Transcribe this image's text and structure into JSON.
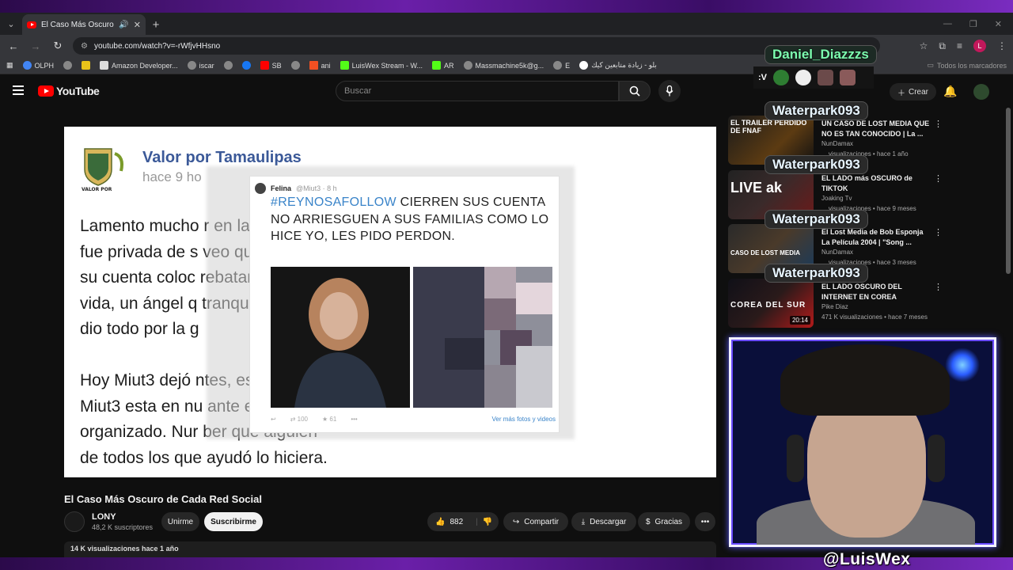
{
  "browser": {
    "tab_title": "El Caso Más Oscuro de Cad",
    "url": "youtube.com/watch?v=-rWfjvHHsno",
    "bookmarks": [
      "OLPH",
      "",
      "Amazon Developer...",
      "iscar",
      "",
      "",
      "SB",
      "",
      "ani",
      "LuisWex Stream - W...",
      "AR",
      "Massmachine5k@g...",
      "E",
      "بلو - زيادة متابعين كيك"
    ],
    "bookmarks_right": "Todos los marcadores",
    "avatar_letter": "L"
  },
  "youtube": {
    "logo_text": "YouTube",
    "search_placeholder": "Buscar",
    "create_label": "Crear"
  },
  "video": {
    "page_name": "Valor por Tamaulipas",
    "page_time": "hace 9 ho",
    "shield_caption": "VALOR POR TAMAULIPAS",
    "post_text": "Lamento mucho                                                    r en la mañana\nfue privada de s                                                 veo que desde\nsu cuenta coloc                                                  rebataron a\nvida, un ángel q                                                 tranquilidad, lo\ndio todo por la g\n\nHoy Miut3 dejó                                                  ntes, es que\nMiut3 esta en nu                                                 ante el crimen\norganizado. Nur                                                  ber que alguien\nde todos los que ayudó lo hiciera.",
    "tweet": {
      "name": "Felina",
      "handle": "@Miut3 · 8 h",
      "hashtag": "#REYNOSAFOLLOW",
      "text": " CIERREN SUS CUENTA NO ARRIESGUEN A SUS FAMILIAS COMO LO HICE YO,  LES PIDO PERDON.",
      "retweets": "100",
      "favs": "61",
      "more_link": "Ver más fotos y videos"
    },
    "title": "El Caso Más Oscuro de Cada Red Social",
    "channel": "LONY",
    "subscribers": "48,2 K suscriptores",
    "join_label": "Unirme",
    "subscribe_label": "Suscribirme",
    "likes": "882",
    "share_label": "Compartir",
    "download_label": "Descargar",
    "thanks_label": "Gracias",
    "views_line": "14 K visualizaciones  hace 1 año"
  },
  "recommendations": [
    {
      "overlay": "EL TRAILER PERDIDO DE FNAF",
      "title": "UN CASO DE LOST MEDIA QUE NO ES TAN CONOCIDO | La ...",
      "channel": "NunDamax",
      "meta": "... visualizaciones • hace 1 año",
      "duration": ""
    },
    {
      "overlay": "LIVE  ak",
      "title": "EL LADO más OSCURO de TIKTOK",
      "channel": "Joaking Tv",
      "meta": "... visualizaciones • hace 9 meses",
      "duration": ""
    },
    {
      "overlay": "CASO DE LOST MEDIA",
      "title": "El Lost Media de Bob Esponja La Película 2004 | \"Song ...",
      "channel": "NunDamax",
      "meta": "... visualizaciones • hace 3 meses",
      "duration": ""
    },
    {
      "overlay": "COREA DEL SUR",
      "title": "EL LADO OSCURO DEL INTERNET EN COREA",
      "channel": "Pike Diaz",
      "meta": "471 K visualizaciones • hace 7 meses",
      "duration": "20:14"
    }
  ],
  "stream_overlay": {
    "chat_names": [
      "Daniel_Diazzzs",
      "Waterpark093",
      "Waterpark093",
      "Waterpark093",
      "Waterpark093"
    ],
    "badge_text": ":V",
    "handle": "@LuisWex"
  },
  "colors": {
    "yt_red": "#ff0000",
    "hashtag_blue": "#3a84c9",
    "facebook_blue": "#3b5998",
    "frame_purple": "#6a1fa8"
  }
}
